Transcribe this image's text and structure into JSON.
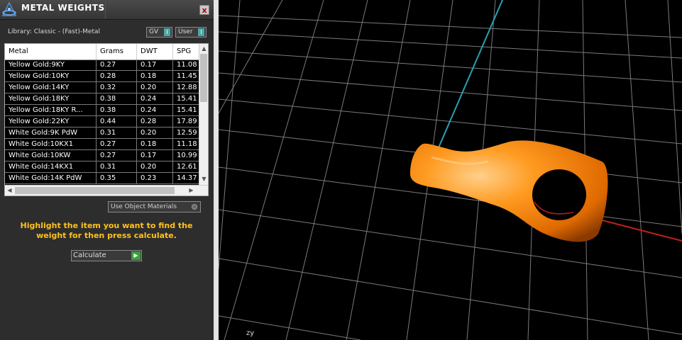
{
  "panel": {
    "title": "METAL WEIGHTS",
    "close_label": "x",
    "library_label": "Library: Classic - (Fast)-Metal",
    "filters": [
      {
        "label": "GV",
        "indicator": "I"
      },
      {
        "label": "User",
        "indicator": "I"
      }
    ],
    "table": {
      "columns": [
        "Metal",
        "Grams",
        "DWT",
        "SPG"
      ],
      "rows": [
        [
          "Yellow Gold:9KY",
          "0.27",
          "0.17",
          "11.08"
        ],
        [
          "Yellow Gold:10KY",
          "0.28",
          "0.18",
          "11.45"
        ],
        [
          "Yellow Gold:14KY",
          "0.32",
          "0.20",
          "12.88"
        ],
        [
          "Yellow Gold:18KY",
          "0.38",
          "0.24",
          "15.41"
        ],
        [
          "Yellow Gold:18KY R...",
          "0.38",
          "0.24",
          "15.41"
        ],
        [
          "Yellow Gold:22KY",
          "0.44",
          "0.28",
          "17.89"
        ],
        [
          "White Gold:9K PdW",
          "0.31",
          "0.20",
          "12.59"
        ],
        [
          "White Gold:10KX1",
          "0.27",
          "0.18",
          "11.18"
        ],
        [
          "White Gold:10KW",
          "0.27",
          "0.17",
          "10.99"
        ],
        [
          "White Gold:14KX1",
          "0.31",
          "0.20",
          "12.61"
        ],
        [
          "White Gold:14K PdW",
          "0.35",
          "0.23",
          "14.37"
        ]
      ]
    },
    "use_object_materials_label": "Use Object Materials",
    "instruction": "Highlight the item you want to find the weight for then press calculate.",
    "calculate_label": "Calculate"
  },
  "viewport": {
    "axis_indicator": "zy",
    "colors": {
      "grid": "#8a8a8a",
      "y_axis": "#2aa0b0",
      "x_axis": "#c0201a",
      "object": "#ff8c00"
    }
  },
  "colors": {
    "accent_instruction": "#ffc21a",
    "indicator_teal": "#4aa9a8",
    "go_green": "#3aa03a"
  }
}
